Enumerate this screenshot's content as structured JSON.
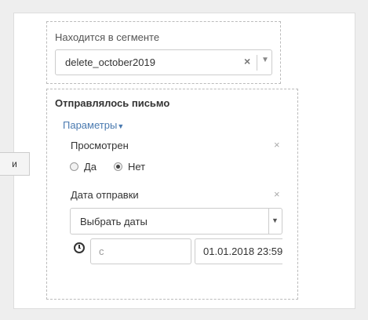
{
  "side_tab": {
    "label": "и"
  },
  "segment": {
    "label": "Находится в сегменте",
    "value": "delete_october2019",
    "clear_icon": "close-icon",
    "dropdown_icon": "chevron-down-icon"
  },
  "email_condition": {
    "title": "Отправлялось письмо",
    "params_label": "Параметры",
    "viewed": {
      "label": "Просмотрен",
      "close_symbol": "×",
      "options": [
        {
          "label": "Да",
          "checked": false
        },
        {
          "label": "Нет",
          "checked": true
        }
      ]
    },
    "send_date": {
      "label": "Дата отправки",
      "close_symbol": "×",
      "select_value": "Выбрать даты",
      "from_placeholder": "с",
      "to_value": "01.01.2018 23:59"
    }
  },
  "colors": {
    "link": "#4a7ab0",
    "border": "#cccccc",
    "background": "#eeeeee"
  }
}
